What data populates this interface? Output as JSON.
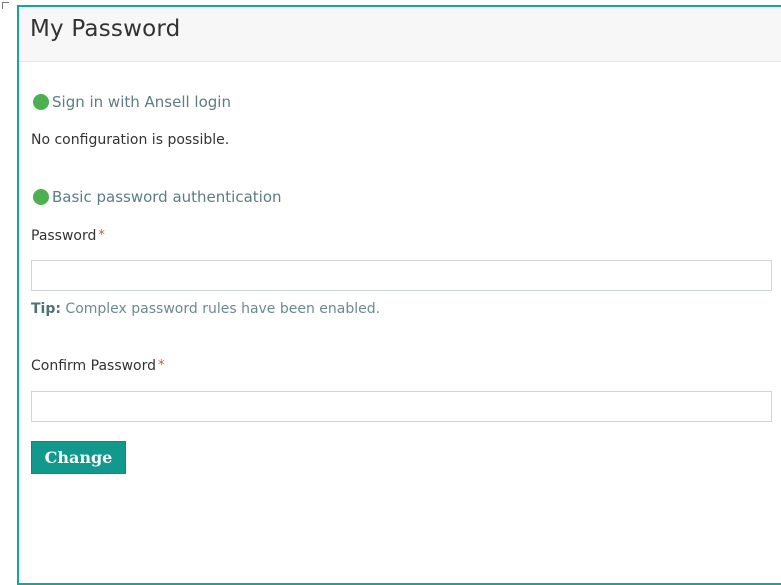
{
  "page": {
    "title": "My Password"
  },
  "sections": {
    "ansell": {
      "heading": "Sign in with Ansell login",
      "message": "No configuration is possible."
    },
    "basic": {
      "heading": "Basic password authentication",
      "password_label": "Password",
      "required_marker": "*",
      "password_value": "",
      "tip_label": "Tip:",
      "tip_text": " Complex password rules have been enabled.",
      "confirm_label": "Confirm Password",
      "confirm_value": ""
    }
  },
  "actions": {
    "change_label": "Change"
  },
  "colors": {
    "accent": "#16a59a",
    "status_dot": "#4caf50",
    "required": "#e44848",
    "button": "#11998e"
  },
  "icons": {
    "status": "green-dot-icon"
  }
}
